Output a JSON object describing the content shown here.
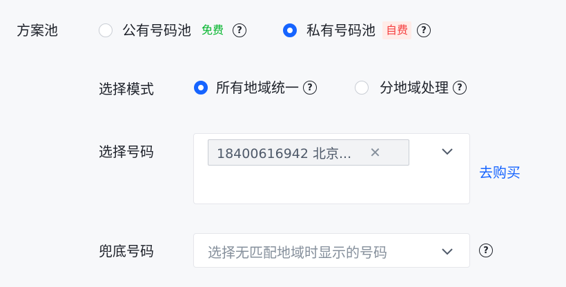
{
  "pool": {
    "label": "方案池",
    "options": [
      {
        "label": "公有号码池",
        "tag": "免费",
        "checked": false
      },
      {
        "label": "私有号码池",
        "tag": "自费",
        "checked": true
      }
    ]
  },
  "mode": {
    "label": "选择模式",
    "options": [
      {
        "label": "所有地域统一",
        "checked": true
      },
      {
        "label": "分地域处理",
        "checked": false
      }
    ]
  },
  "number": {
    "label": "选择号码",
    "selected_tag": "18400616942 北京...",
    "buy_link": "去购买"
  },
  "fallback": {
    "label": "兜底号码",
    "placeholder": "选择无匹配地域时显示的号码"
  },
  "icons": {
    "help": "question-circle-icon",
    "close": "close-icon",
    "chevron": "chevron-down-icon"
  },
  "colors": {
    "primary": "#1664ff",
    "free": "#00b42a",
    "paid": "#f53f3f"
  }
}
